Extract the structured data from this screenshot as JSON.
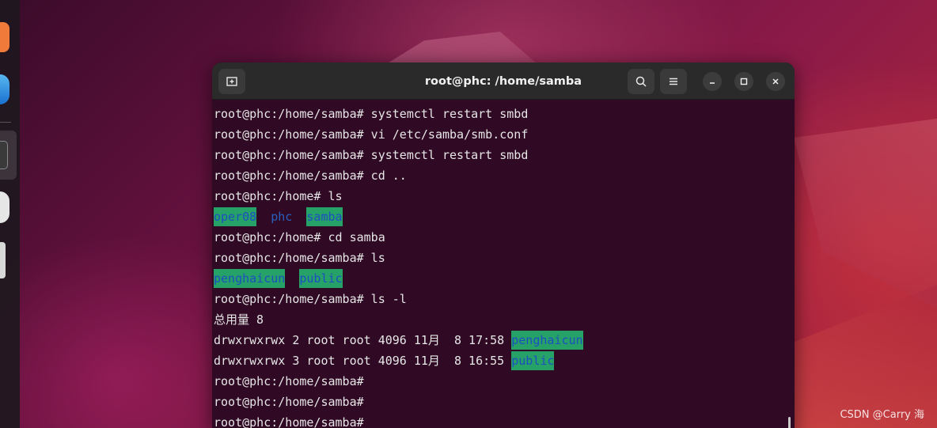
{
  "window": {
    "title": "root@phc: /home/samba"
  },
  "terminal": {
    "lines": [
      {
        "type": "cmd",
        "prompt": "root@phc:/home/samba#",
        "cmd": " systemctl restart smbd"
      },
      {
        "type": "cmd",
        "prompt": "root@phc:/home/samba#",
        "cmd": " vi /etc/samba/smb.conf"
      },
      {
        "type": "cmd",
        "prompt": "root@phc:/home/samba#",
        "cmd": " systemctl restart smbd"
      },
      {
        "type": "cmd",
        "prompt": "root@phc:/home/samba#",
        "cmd": " cd .."
      },
      {
        "type": "cmd",
        "prompt": "root@phc:/home#",
        "cmd": " ls"
      },
      {
        "type": "ls",
        "items": [
          {
            "name": "oper08",
            "highlight": true
          },
          {
            "name": "phc",
            "highlight": false
          },
          {
            "name": "samba",
            "highlight": true
          }
        ]
      },
      {
        "type": "cmd",
        "prompt": "root@phc:/home#",
        "cmd": " cd samba"
      },
      {
        "type": "cmd",
        "prompt": "root@phc:/home/samba#",
        "cmd": " ls"
      },
      {
        "type": "ls",
        "items": [
          {
            "name": "penghaicun",
            "highlight": true
          },
          {
            "name": "public",
            "highlight": true
          }
        ]
      },
      {
        "type": "cmd",
        "prompt": "root@phc:/home/samba#",
        "cmd": " ls -l"
      },
      {
        "type": "text",
        "text": "总用量 8"
      },
      {
        "type": "ll",
        "text": "drwxrwxrwx 2 root root 4096 11月  8 17:58 ",
        "name": "penghaicun"
      },
      {
        "type": "ll",
        "text": "drwxrwxrwx 3 root root 4096 11月  8 16:55 ",
        "name": "public"
      },
      {
        "type": "cmd",
        "prompt": "root@phc:/home/samba#",
        "cmd": ""
      },
      {
        "type": "cmd",
        "prompt": "root@phc:/home/samba#",
        "cmd": ""
      },
      {
        "type": "cmd",
        "prompt": "root@phc:/home/samba#",
        "cmd": ""
      }
    ]
  },
  "icons": {
    "new_tab": "new-tab-icon",
    "search": "search-icon",
    "menu": "hamburger-menu-icon",
    "minimize": "minimize-icon",
    "maximize": "maximize-icon",
    "close": "close-icon"
  },
  "colors": {
    "terminal_bg": "#300a24",
    "dir_highlight_bg": "#26a269",
    "dir_text": "#2860bf"
  },
  "watermark": "CSDN @Carry 海"
}
